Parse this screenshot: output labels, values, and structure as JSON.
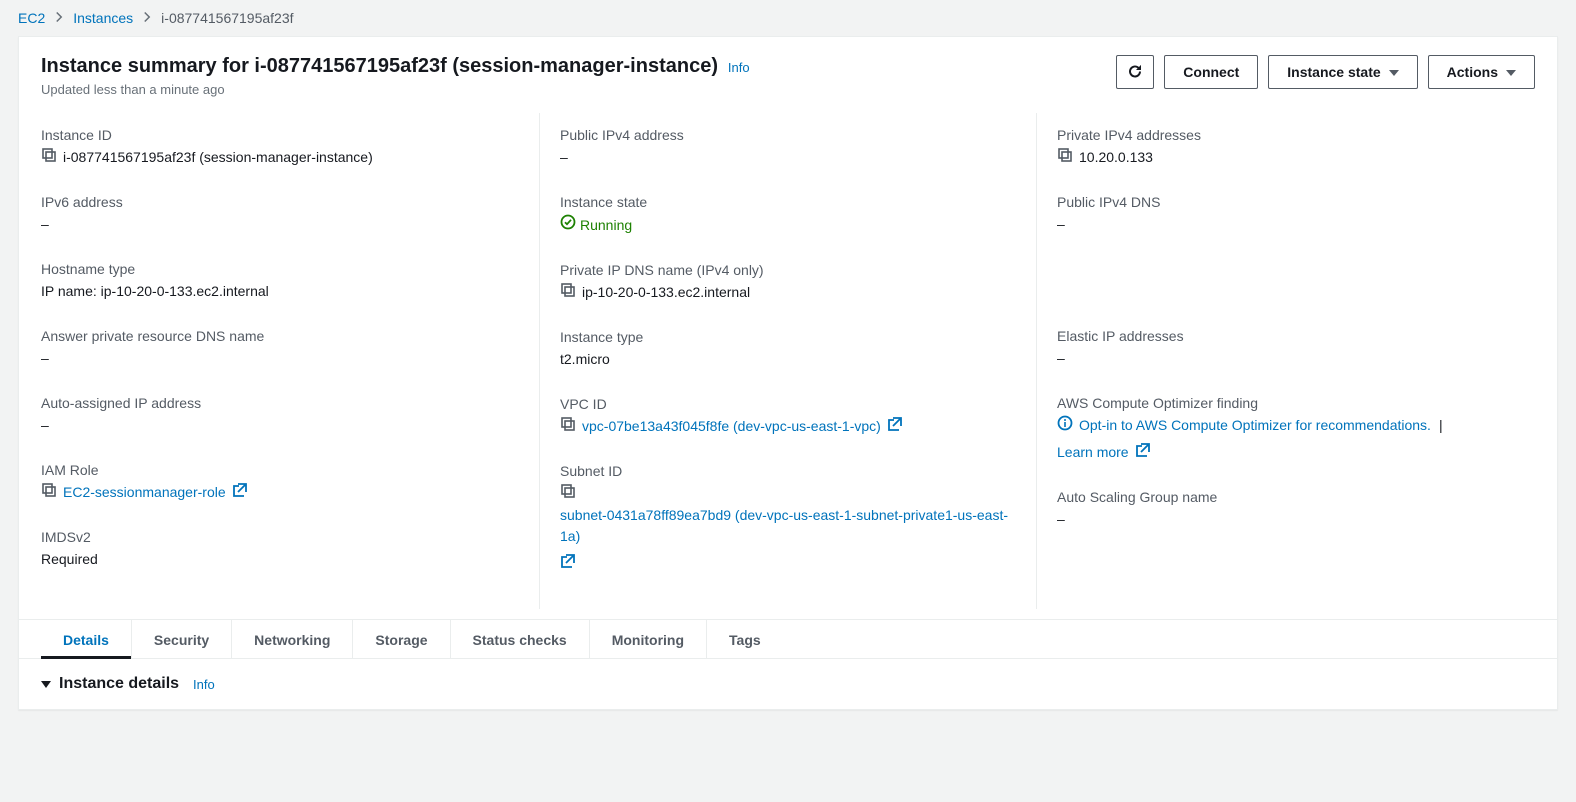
{
  "breadcrumb": {
    "root": "EC2",
    "instances": "Instances",
    "current": "i-087741567195af23f"
  },
  "header": {
    "title": "Instance summary for i-087741567195af23f (session-manager-instance)",
    "info": "Info",
    "subtitle": "Updated less than a minute ago",
    "connect": "Connect",
    "instanceState": "Instance state",
    "actions": "Actions"
  },
  "fields": {
    "instanceId": {
      "label": "Instance ID",
      "value": "i-087741567195af23f (session-manager-instance)"
    },
    "publicIpv4": {
      "label": "Public IPv4 address",
      "value": "–"
    },
    "privateIpv4": {
      "label": "Private IPv4 addresses",
      "value": "10.20.0.133"
    },
    "ipv6": {
      "label": "IPv6 address",
      "value": "–"
    },
    "instanceState": {
      "label": "Instance state",
      "value": "Running"
    },
    "publicDns": {
      "label": "Public IPv4 DNS",
      "value": "–"
    },
    "hostnameType": {
      "label": "Hostname type",
      "value": "IP name: ip-10-20-0-133.ec2.internal"
    },
    "privateDns": {
      "label": "Private IP DNS name (IPv4 only)",
      "value": "ip-10-20-0-133.ec2.internal"
    },
    "answerDns": {
      "label": "Answer private resource DNS name",
      "value": "–"
    },
    "instanceType": {
      "label": "Instance type",
      "value": "t2.micro"
    },
    "elasticIp": {
      "label": "Elastic IP addresses",
      "value": "–"
    },
    "autoAssignedIp": {
      "label": "Auto-assigned IP address",
      "value": "–"
    },
    "vpcId": {
      "label": "VPC ID",
      "value": "vpc-07be13a43f045f8fe (dev-vpc-us-east-1-vpc)"
    },
    "computeOptimizer": {
      "label": "AWS Compute Optimizer finding",
      "optIn": "Opt-in to AWS Compute Optimizer for recommendations.",
      "learnMore": "Learn more"
    },
    "iamRole": {
      "label": "IAM Role",
      "value": "EC2-sessionmanager-role"
    },
    "subnetId": {
      "label": "Subnet ID",
      "value": "subnet-0431a78ff89ea7bd9 (dev-vpc-us-east-1-subnet-private1-us-east-1a)"
    },
    "asg": {
      "label": "Auto Scaling Group name",
      "value": "–"
    },
    "imdsv2": {
      "label": "IMDSv2",
      "value": "Required"
    }
  },
  "tabs": {
    "details": "Details",
    "security": "Security",
    "networking": "Networking",
    "storage": "Storage",
    "statusChecks": "Status checks",
    "monitoring": "Monitoring",
    "tags": "Tags"
  },
  "subpanel": {
    "title": "Instance details",
    "info": "Info"
  }
}
